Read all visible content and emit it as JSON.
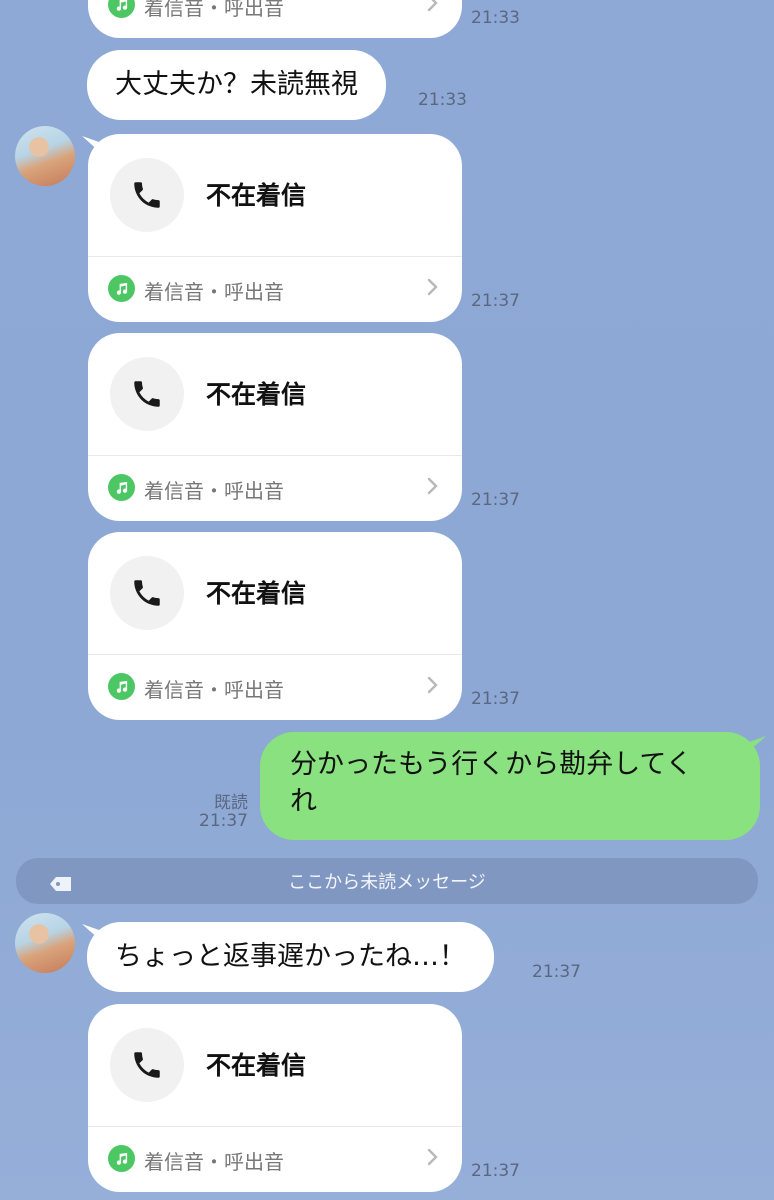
{
  "colors": {
    "background": "#8fa9d6",
    "sent_bubble": "#89e17f",
    "received_bubble": "#ffffff",
    "music_icon_bg": "#4cc764"
  },
  "top_partial": {
    "ringtone_label": "着信音・呼出音",
    "time": "21:33"
  },
  "message_1": {
    "text": "大丈夫か？未読無視",
    "time": "21:33"
  },
  "missed_calls": [
    {
      "title": "不在着信",
      "ringtone_label": "着信音・呼出音",
      "time": "21:37"
    },
    {
      "title": "不在着信",
      "ringtone_label": "着信音・呼出音",
      "time": "21:37"
    },
    {
      "title": "不在着信",
      "ringtone_label": "着信音・呼出音",
      "time": "21:37"
    },
    {
      "title": "不在着信",
      "ringtone_label": "着信音・呼出音",
      "time": "21:37"
    }
  ],
  "sent_message": {
    "line1": "分かったもう行くから勘弁してく",
    "line2": "れ",
    "read_label": "既読",
    "time": "21:37"
  },
  "unread_divider": {
    "label": "ここから未読メッセージ"
  },
  "message_2": {
    "text": "ちょっと返事遅かったね…！",
    "time": "21:37"
  }
}
